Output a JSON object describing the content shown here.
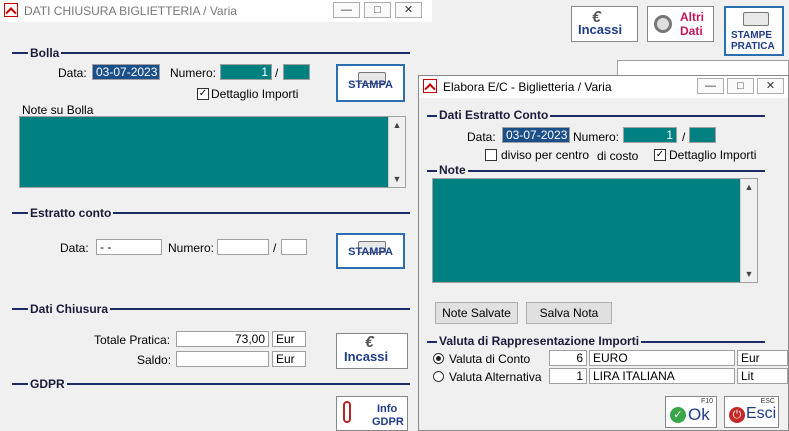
{
  "main_window": {
    "title": "DATI CHIUSURA BIGLIETTERIA / Varia",
    "controls": {
      "minimize": "—",
      "maximize": "□",
      "close": "✕"
    },
    "bolla": {
      "section": "Bolla",
      "data_label": "Data:",
      "data_value": "03-07-2023",
      "numero_label": "Numero:",
      "numero_value": "1",
      "slash": "/",
      "dettaglio_label": "Dettaglio Importi",
      "dettaglio_checked": true,
      "stampa_label": "STAMPA",
      "note_label": "Note su Bolla"
    },
    "estratto": {
      "section": "Estratto conto",
      "data_label": "Data:",
      "data_value": " - -",
      "numero_label": "Numero:",
      "slash": "/",
      "stampa_label": "STAMPA"
    },
    "chiusura": {
      "section": "Dati Chiusura",
      "totale_label": "Totale Pratica:",
      "totale_value": "73,00",
      "totale_currency": "Eur",
      "saldo_label": "Saldo:",
      "saldo_value": "",
      "saldo_currency": "Eur",
      "incassi_label": "Incassi"
    },
    "gdpr": {
      "section": "GDPR",
      "info_label_1": "Info",
      "info_label_2": "GDPR"
    }
  },
  "toolbar": {
    "incassi": "Incassi",
    "altri_dati_1": "Altri",
    "altri_dati_2": "Dati",
    "stampe_1": "STAMPE",
    "stampe_2": "PRATICA"
  },
  "dialog": {
    "title": "Elabora E/C - Biglietteria / Varia",
    "controls": {
      "minimize": "—",
      "maximize": "□",
      "close": "✕"
    },
    "estratto": {
      "section": "Dati Estratto Conto",
      "data_label": "Data:",
      "data_value": "03-07-2023",
      "numero_label": "Numero:",
      "numero_value": "1",
      "slash": "/",
      "diviso_label": "diviso per centro",
      "di_costo_label": "di costo",
      "diviso_checked": false,
      "dettaglio_label": "Dettaglio Importi",
      "dettaglio_checked": true
    },
    "note": {
      "section": "Note"
    },
    "buttons": {
      "note_salvate": "Note Salvate",
      "salva_nota": "Salva Nota"
    },
    "valuta": {
      "section": "Valuta di Rappresentazione Importi",
      "options": [
        {
          "label": "Valuta di Conto",
          "code": "6",
          "name": "EURO",
          "abbr": "Eur",
          "selected": true
        },
        {
          "label": "Valuta Alternativa",
          "code": "1",
          "name": "LIRA ITALIANA",
          "abbr": "Lit",
          "selected": false
        }
      ]
    },
    "ok": {
      "label": "Ok",
      "key": "F10"
    },
    "esci": {
      "label": "Esci",
      "key": "ESC"
    }
  }
}
